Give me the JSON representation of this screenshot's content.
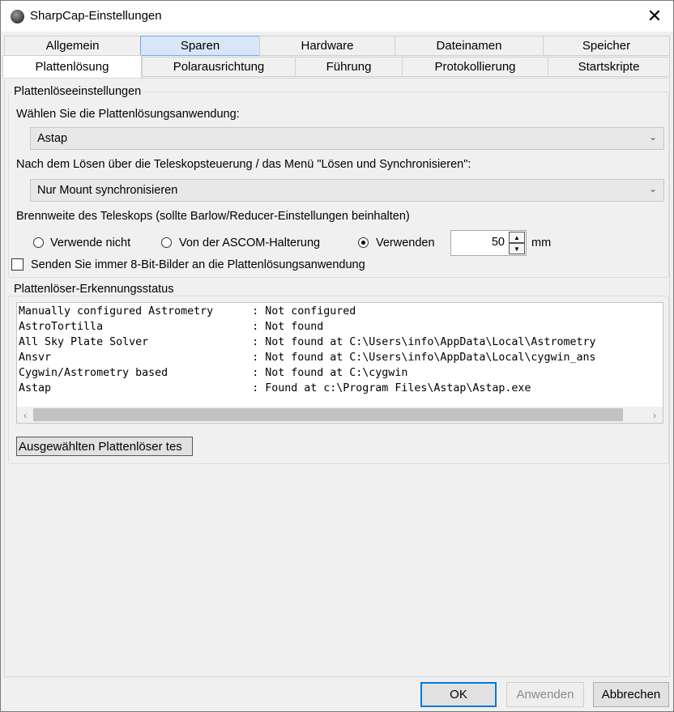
{
  "window": {
    "title": "SharpCap-Einstellungen",
    "close_glyph": "✕"
  },
  "tabs_row1": [
    "Allgemein",
    "Sparen",
    "Hardware",
    "Dateinamen",
    "Speicher"
  ],
  "tabs_row2": [
    "Plattenlösung",
    "Polarausrichtung",
    "Führung",
    "Protokollierung",
    "Startskripte"
  ],
  "active_tab": "Plattenlösung",
  "settings_group": {
    "title": "Plattenlöseeinstellungen",
    "solver_label": "Wählen Sie die Plattenlösungsanwendung:",
    "solver_value": "Astap",
    "after_solve_label": "Nach dem Lösen über die Teleskopsteuerung / das Menü \"Lösen und Synchronisieren\":",
    "after_solve_value": "Nur Mount synchronisieren",
    "focal_label": "Brennweite des Teleskops (sollte Barlow/Reducer-Einstellungen beinhalten)",
    "radio_not_use": "Verwende nicht",
    "radio_ascom": "Von der ASCOM-Halterung",
    "radio_use": "Verwenden",
    "selected_radio": "Verwenden",
    "focal_value": "50",
    "focal_unit": "mm",
    "checkbox_label": "Senden Sie immer 8-Bit-Bilder an die Plattenlösungsanwendung",
    "checkbox_checked": false
  },
  "status_group": {
    "title": "Plattenlöser-Erkennungsstatus",
    "lines": [
      "Manually configured Astrometry      : Not configured",
      "AstroTortilla                       : Not found",
      "All Sky Plate Solver                : Not found at C:\\Users\\info\\AppData\\Local\\Astrometry",
      "Ansvr                               : Not found at C:\\Users\\info\\AppData\\Local\\cygwin_ans",
      "Cygwin/Astrometry based             : Not found at C:\\cygwin",
      "Astap                               : Found at c:\\Program Files\\Astap\\Astap.exe"
    ],
    "test_button": "Ausgewählten Plattenlöser tes"
  },
  "footer": {
    "ok": "OK",
    "apply": "Anwenden",
    "cancel": "Abbrechen"
  }
}
